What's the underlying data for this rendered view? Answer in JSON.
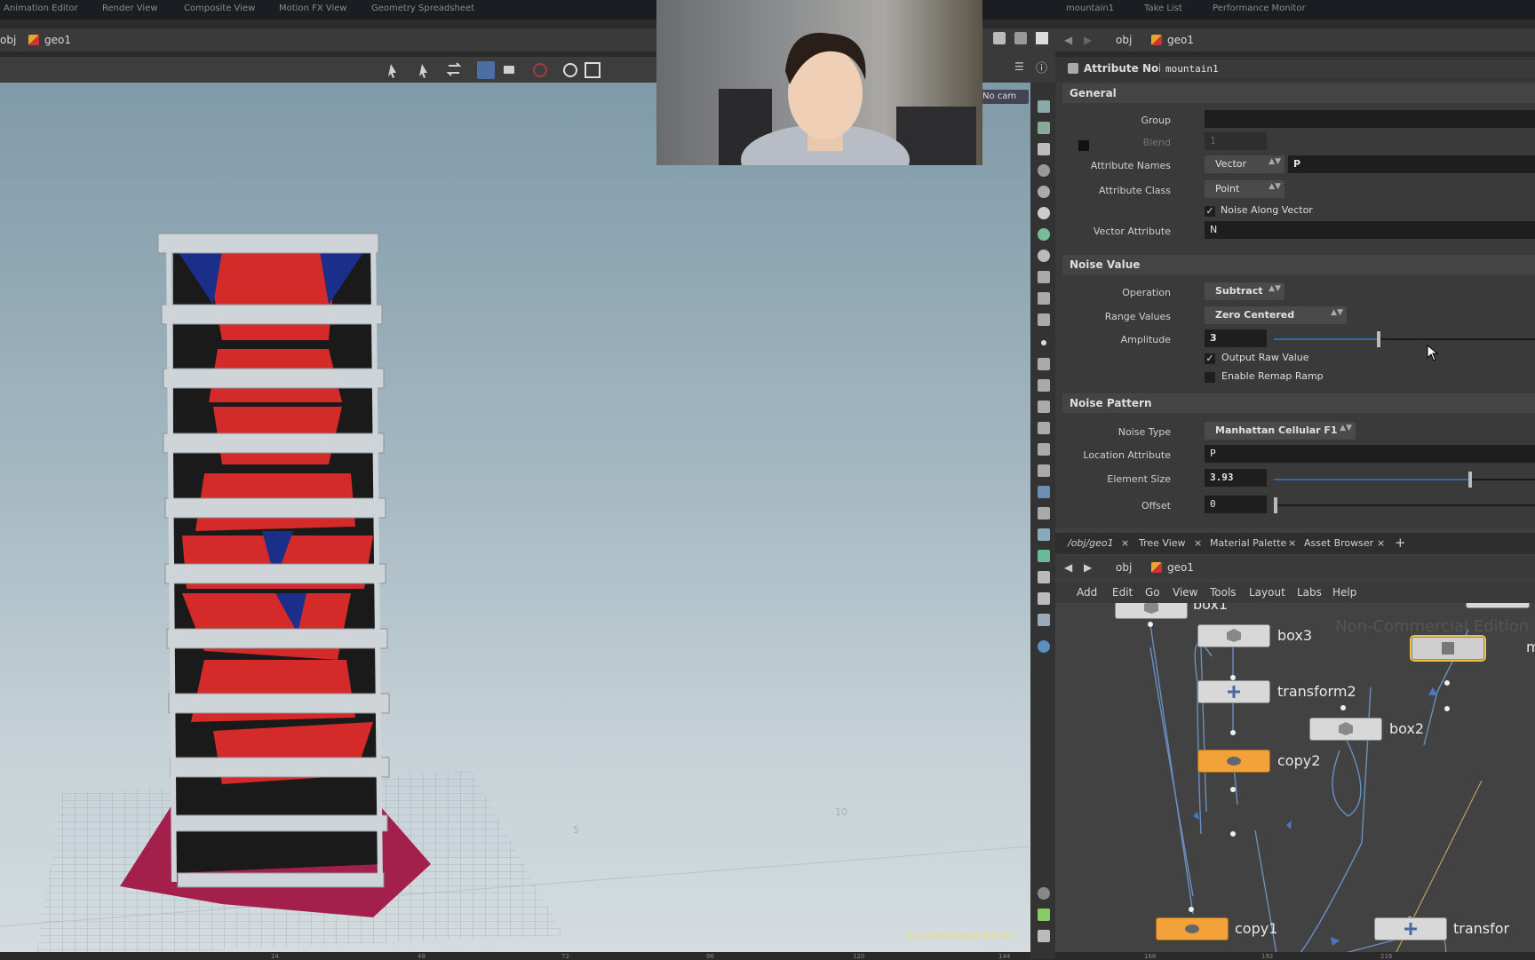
{
  "top_tabs": [
    "Animation Editor",
    "Render View",
    "Composite View",
    "Motion FX View",
    "Geometry Spreadsheet",
    "mountain1",
    "Take List",
    "Performance Monitor"
  ],
  "left_path": {
    "root": "obj",
    "node": "geo1"
  },
  "viewport": {
    "cam_label": "No cam",
    "watermark": "Non-Commercial Edition",
    "grid_labels": [
      "5",
      "10"
    ]
  },
  "right_path": {
    "root": "obj",
    "node": "geo1"
  },
  "params": {
    "node_type": "Attribute Noise",
    "node_name": "mountain1",
    "general_section": "General",
    "group_label": "Group",
    "group_value": "",
    "blend_label": "Blend",
    "blend_value": "1",
    "attr_names_label": "Attribute Names",
    "attr_names_type": "Vector",
    "attr_names_value": "P",
    "attr_class_label": "Attribute Class",
    "attr_class_value": "Point",
    "noise_along_vector": "Noise Along Vector",
    "vector_attr_label": "Vector Attribute",
    "vector_attr_value": "N",
    "noise_value_section": "Noise Value",
    "operation_label": "Operation",
    "operation_value": "Subtract",
    "range_label": "Range Values",
    "range_value": "Zero Centered",
    "amplitude_label": "Amplitude",
    "amplitude_value": "3",
    "amplitude_fraction": 0.4,
    "output_raw": "Output Raw Value",
    "enable_remap": "Enable Remap Ramp",
    "noise_pattern_section": "Noise Pattern",
    "noise_type_label": "Noise Type",
    "noise_type_value": "Manhattan Cellular F1",
    "location_attr_label": "Location Attribute",
    "location_attr_value": "P",
    "element_size_label": "Element Size",
    "element_size_value": "3.93",
    "element_size_fraction": 0.75,
    "offset_label": "Offset",
    "offset_value": "0"
  },
  "network": {
    "tabs": [
      "/obj/geo1",
      "Tree View",
      "Material Palette",
      "Asset Browser"
    ],
    "path": {
      "root": "obj",
      "node": "geo1"
    },
    "menu": [
      "Add",
      "Edit",
      "Go",
      "View",
      "Tools",
      "Layout",
      "Labs",
      "Help"
    ],
    "watermark": "Non-Commercial Edition",
    "nodes": {
      "box1": "box1",
      "box3": "box3",
      "transform2": "transform2",
      "box2": "box2",
      "copy2": "copy2",
      "copy1": "copy1",
      "transform": "transfor",
      "mountain": "m"
    }
  },
  "timeline": {
    "ticks": [
      "24",
      "48",
      "72",
      "96",
      "120",
      "144",
      "168",
      "192",
      "216"
    ]
  },
  "colors": {
    "accent_blue": "#2f6ab0",
    "orange_node": "#f3a23b",
    "selected_outline": "#f0c040",
    "red_geo": "#d42a2a"
  }
}
